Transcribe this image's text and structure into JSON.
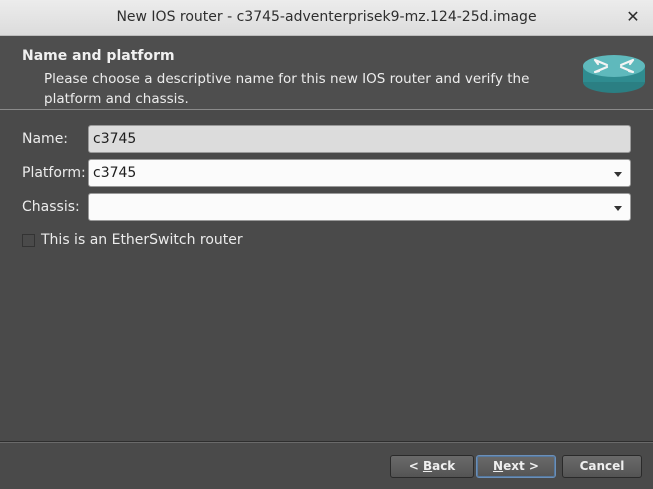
{
  "window": {
    "title": "New IOS router - c3745-adventerprisek9-mz.124-25d.image",
    "close_glyph": "✕"
  },
  "header": {
    "title": "Name and platform",
    "subtitle": "Please choose a descriptive name for this new IOS router and verify the platform and chassis.",
    "icon": "router-icon"
  },
  "form": {
    "name_label": "Name:",
    "name_value": "c3745",
    "platform_label": "Platform:",
    "platform_value": "c3745",
    "chassis_label": "Chassis:",
    "chassis_value": "",
    "etherswitch_label": "This is an EtherSwitch router",
    "etherswitch_checked": false
  },
  "buttons": {
    "back_prefix": "< ",
    "back_mnemonic": "B",
    "back_rest": "ack",
    "next_mnemonic": "N",
    "next_rest": "ext >",
    "cancel": "Cancel"
  },
  "colors": {
    "background": "#4a4a4a",
    "router_teal": "#3aa0a4",
    "focus_border": "#6b8fb8"
  }
}
